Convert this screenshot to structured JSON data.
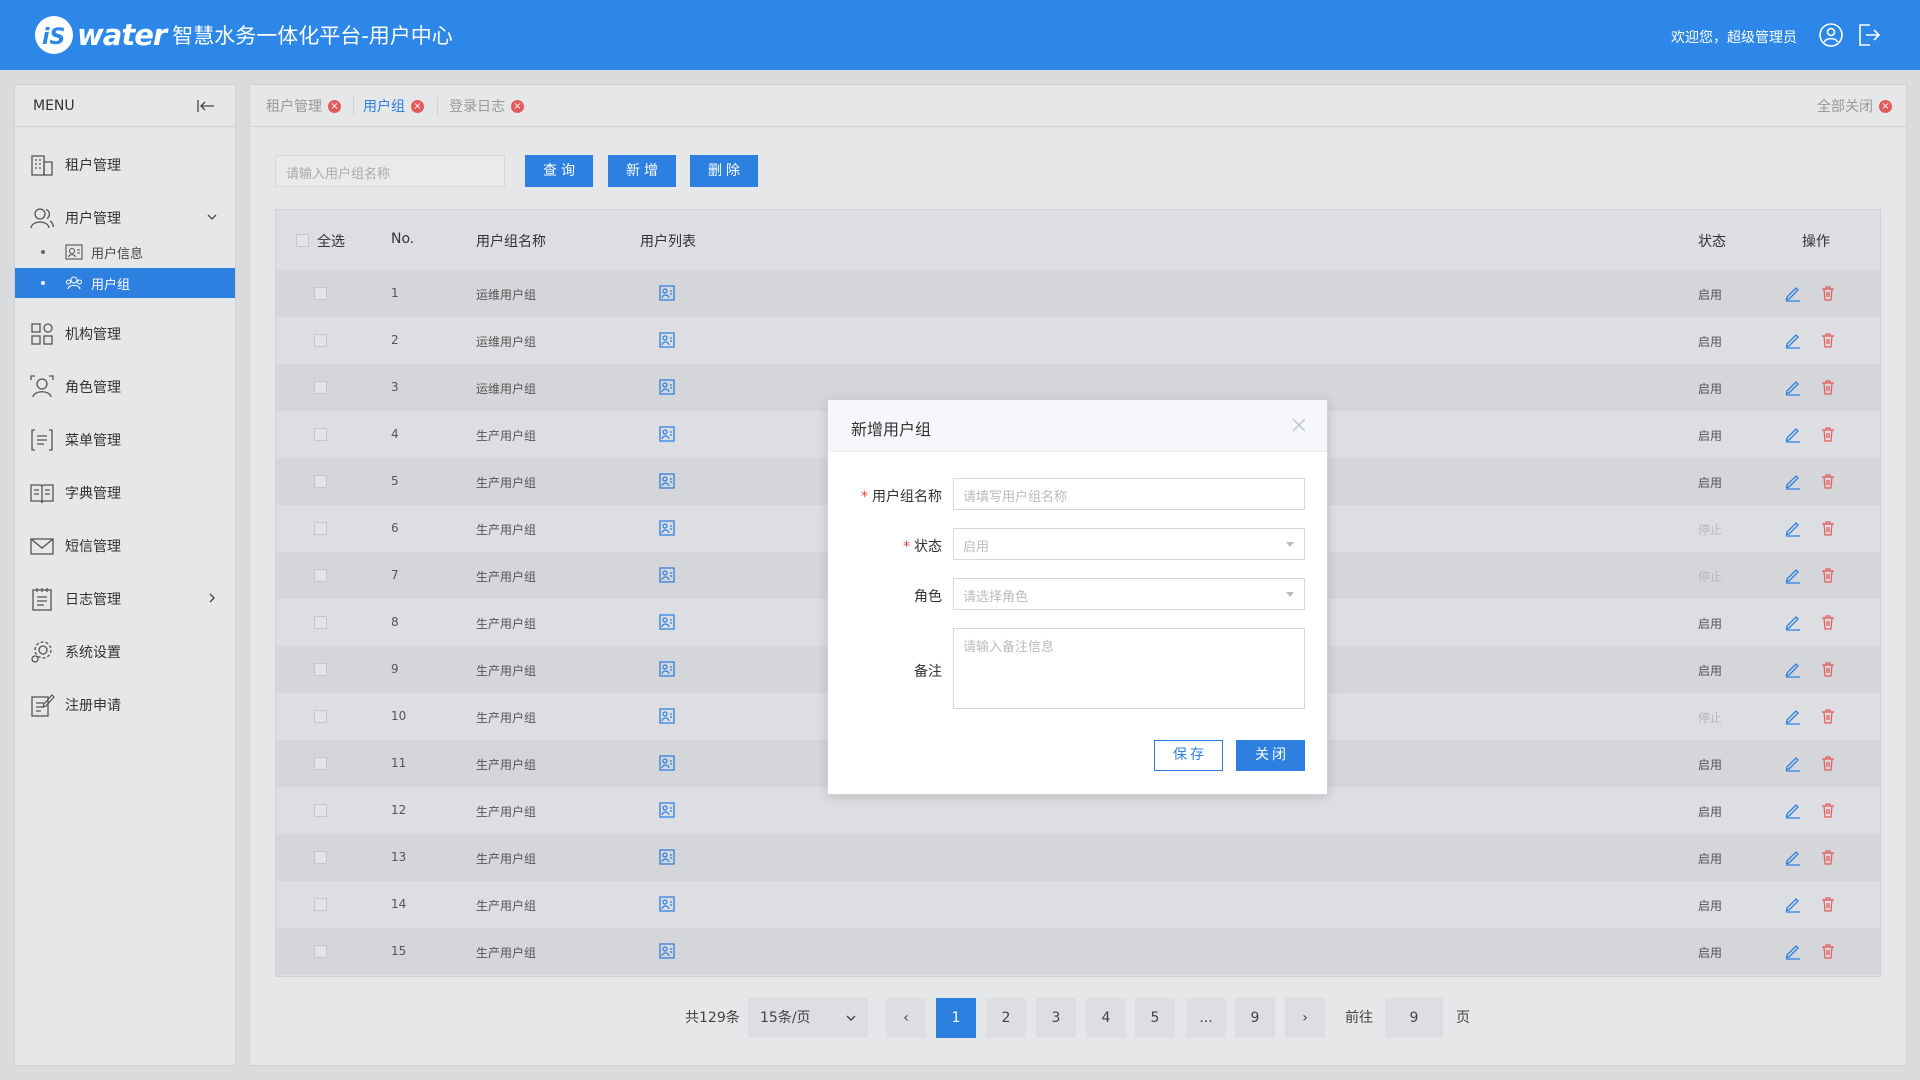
{
  "header": {
    "logo_text": "water",
    "logo_prefix": "iS",
    "app_title": "智慧水务一体化平台-用户中心",
    "welcome": "欢迎您，超级管理员",
    "icons": [
      "user-icon",
      "logout-icon"
    ]
  },
  "sidebar": {
    "menu_label": "MENU",
    "items": [
      {
        "label": "租户管理",
        "icon": "tenant-icon"
      },
      {
        "label": "用户管理",
        "icon": "users-icon"
      },
      {
        "label": "机构管理",
        "icon": "org-icon"
      },
      {
        "label": "角色管理",
        "icon": "role-icon"
      },
      {
        "label": "菜单管理",
        "icon": "menu-list-icon"
      },
      {
        "label": "字典管理",
        "icon": "dictionary-icon"
      },
      {
        "label": "短信管理",
        "icon": "sms-icon"
      },
      {
        "label": "日志管理",
        "icon": "log-icon"
      },
      {
        "label": "系统设置",
        "icon": "settings-icon"
      },
      {
        "label": "注册申请",
        "icon": "register-icon"
      }
    ],
    "subitems": [
      {
        "label": "用户信息",
        "icon": "user-info-icon",
        "active": false
      },
      {
        "label": "用户组",
        "icon": "user-group-icon",
        "active": true
      }
    ]
  },
  "tabs": {
    "items": [
      {
        "label": "租户管理",
        "active": false
      },
      {
        "label": "用户组",
        "active": true
      },
      {
        "label": "登录日志",
        "active": false
      }
    ],
    "close_all": "全部关闭"
  },
  "toolbar": {
    "search_placeholder": "请输入用户组名称",
    "query": "查询",
    "add": "新增",
    "delete": "删除"
  },
  "table": {
    "headers": {
      "select_all": "全选",
      "no": "No.",
      "name": "用户组名称",
      "users": "用户列表",
      "status": "状态",
      "actions": "操作"
    },
    "rows": [
      {
        "no": "1",
        "name": "运维用户组",
        "status": "启用"
      },
      {
        "no": "2",
        "name": "运维用户组",
        "status": "启用"
      },
      {
        "no": "3",
        "name": "运维用户组",
        "status": "启用"
      },
      {
        "no": "4",
        "name": "生产用户组",
        "status": "启用"
      },
      {
        "no": "5",
        "name": "生产用户组",
        "status": "启用"
      },
      {
        "no": "6",
        "name": "生产用户组",
        "status": "停止"
      },
      {
        "no": "7",
        "name": "生产用户组",
        "status": "停止"
      },
      {
        "no": "8",
        "name": "生产用户组",
        "status": "启用"
      },
      {
        "no": "9",
        "name": "生产用户组",
        "status": "启用"
      },
      {
        "no": "10",
        "name": "生产用户组",
        "status": "停止"
      },
      {
        "no": "11",
        "name": "生产用户组",
        "status": "启用"
      },
      {
        "no": "12",
        "name": "生产用户组",
        "status": "启用"
      },
      {
        "no": "13",
        "name": "生产用户组",
        "status": "启用"
      },
      {
        "no": "14",
        "name": "生产用户组",
        "status": "启用"
      },
      {
        "no": "15",
        "name": "生产用户组",
        "status": "启用"
      }
    ]
  },
  "pagination": {
    "total": "共129条",
    "page_size": "15条/页",
    "pages": [
      "1",
      "2",
      "3",
      "4",
      "5",
      "...",
      "9"
    ],
    "current": "1",
    "prev": "‹",
    "next": "›",
    "goto_label": "前往",
    "goto_value": "9",
    "page_suffix": "页"
  },
  "modal": {
    "title": "新增用户组",
    "fields": {
      "name_label": "用户组名称",
      "name_placeholder": "请填写用户组名称",
      "status_label": "状态",
      "status_value": "启用",
      "role_label": "角色",
      "role_placeholder": "请选择角色",
      "note_label": "备注",
      "note_placeholder": "请输入备注信息"
    },
    "save": "保存",
    "close": "关闭"
  },
  "colors": {
    "primary": "#2d87e8",
    "danger": "#e25b5b",
    "disabled_status": "#b8b8b8"
  }
}
